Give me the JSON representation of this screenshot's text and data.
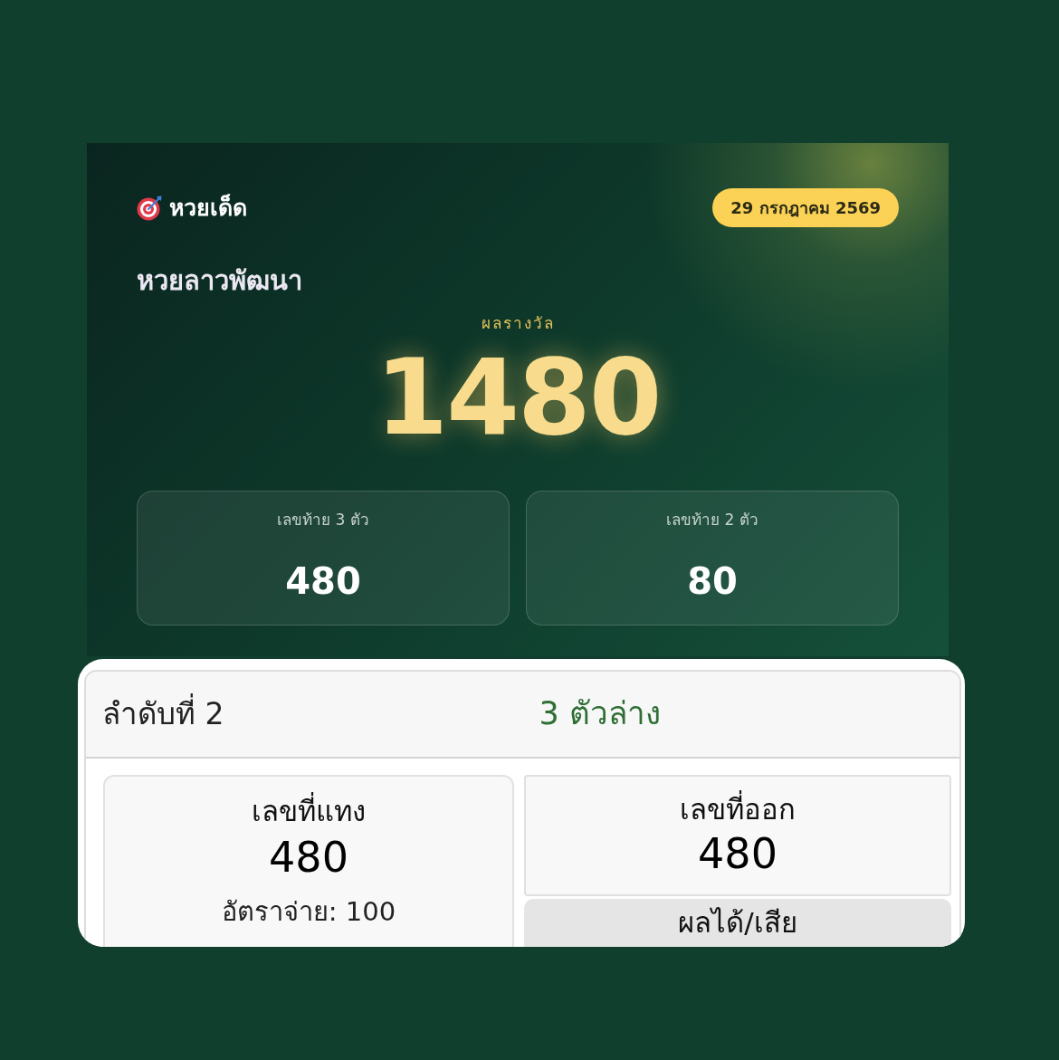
{
  "result_card": {
    "brand": "หวยเด็ด",
    "date": "29 กรกฎาคม 2569",
    "lottery_name": "หวยลาวพัฒนา",
    "prize_label": "ผลรางวัล",
    "prize_number": "1480",
    "sub_results": [
      {
        "label": "เลขท้าย 3 ตัว",
        "number": "480"
      },
      {
        "label": "เลขท้าย 2 ตัว",
        "number": "80"
      }
    ]
  },
  "bet_card": {
    "rank": "ลำดับที่ 2",
    "bet_type": "3 ตัวล่าง",
    "bet_number": {
      "label": "เลขที่แทง",
      "number": "480",
      "payout": "อัตราจ่าย: 100"
    },
    "drawn_number": {
      "label": "เลขที่ออก",
      "number": "480"
    },
    "profit_loss": {
      "label": "ผลได้/เสีย"
    }
  }
}
